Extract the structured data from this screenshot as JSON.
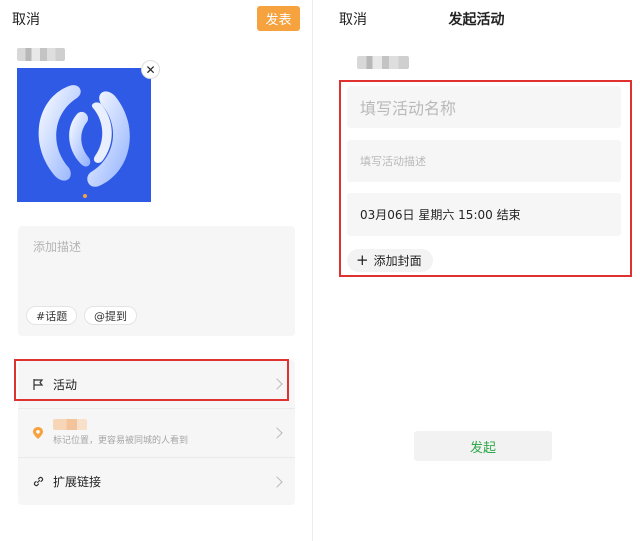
{
  "left": {
    "cancel_label": "取消",
    "publish_label": "发表",
    "close_glyph": "✕",
    "description_placeholder": "添加描述",
    "tags": [
      "#话题",
      "@提到"
    ],
    "rows": {
      "activity_label": "活动",
      "location_hint": "标记位置，更容易被同城的人看到",
      "link_label": "扩展链接"
    },
    "icons": {
      "activity": "flag-icon",
      "location": "location-pin-icon",
      "link": "link-icon",
      "chevron": "chevron-right-icon"
    },
    "colors": {
      "publish": "#f5a23f",
      "cover": "#2f5ae6",
      "location_pin": "#f5a23f",
      "highlight": "#e03131"
    }
  },
  "right": {
    "cancel_label": "取消",
    "title": "发起活动",
    "name_placeholder": "填写活动名称",
    "description_placeholder": "填写活动描述",
    "end_time": "03月06日 星期六 15:00 结束",
    "add_cover_plus": "+",
    "add_cover_label": "添加封面",
    "launch_label": "发起",
    "colors": {
      "launch_text": "#2fa74b",
      "highlight": "#e03131"
    }
  }
}
